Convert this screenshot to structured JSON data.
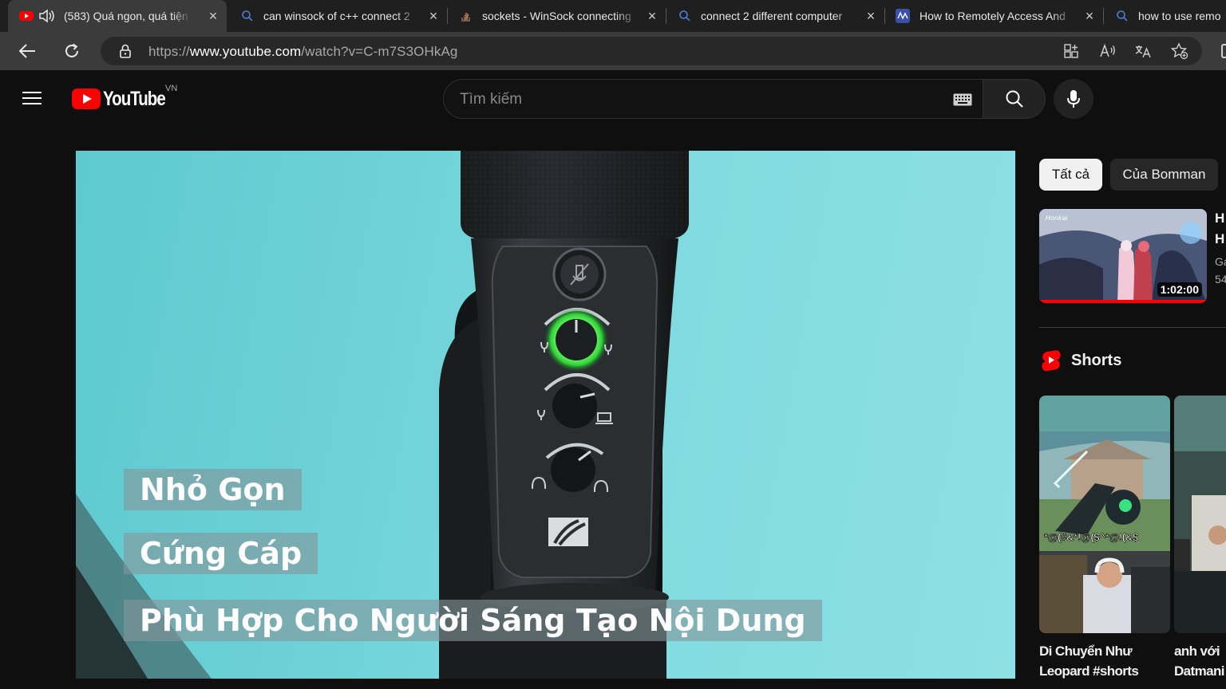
{
  "browser": {
    "tabs": [
      {
        "title": "(583) Quá ngon, quá tiện",
        "favicon": "youtube-icon",
        "active": true,
        "audio": true
      },
      {
        "title": "can winsock of c++ connect 2",
        "favicon": "search-icon",
        "active": false
      },
      {
        "title": "sockets - WinSock connecting",
        "favicon": "stackoverflow-icon",
        "active": false
      },
      {
        "title": "connect 2 different computer",
        "favicon": "search-icon",
        "active": false
      },
      {
        "title": "How to Remotely Access And",
        "favicon": "article-icon",
        "active": false
      },
      {
        "title": "how to use remo",
        "favicon": "search-icon",
        "active": false
      }
    ],
    "url_prefix": "https://",
    "url_domain": "www.youtube.com",
    "url_path": "/watch?v=C-m7S3OHkAg"
  },
  "header": {
    "logo_text": "YouTube",
    "country_code": "VN",
    "search_placeholder": "Tìm kiếm"
  },
  "video": {
    "captions": [
      "Nhỏ Gọn",
      "Cứng Cáp",
      "Phù Hợp Cho Người Sáng Tạo Nội Dung"
    ]
  },
  "sidebar": {
    "chips": [
      "Tất cả",
      "Của Bomman"
    ],
    "recommended": {
      "duration": "1:02:00",
      "progress": 1.0,
      "title_line1": "H",
      "title_line2": "H",
      "channel": "Ga",
      "views": "54"
    },
    "shorts_label": "Shorts",
    "shorts": [
      {
        "title": "Di Chuyển Như Leopard #shorts",
        "title_line1": "Di Chuyển Như",
        "title_line2": "Leopard #shorts",
        "overlay_text": "*@(#&*!@($^*@!(&$"
      },
      {
        "title": "anh với Datmani",
        "title_line1": "anh với",
        "title_line2": "Datmani"
      }
    ]
  },
  "colors": {
    "accent": "#ff0000",
    "background": "#0f0f0f",
    "chrome_bg": "#3b3b3b",
    "video_bg": "#6fd3d8"
  }
}
